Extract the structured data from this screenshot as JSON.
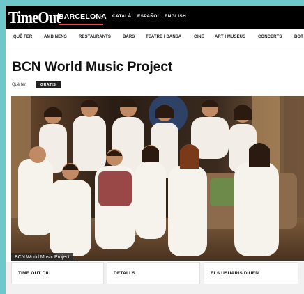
{
  "header": {
    "logo_text": "TimeOut",
    "city": "BARCELONA",
    "languages": [
      "CATALÀ",
      "ESPAÑOL",
      "ENGLISH"
    ]
  },
  "nav": {
    "items": [
      "QUÈ FER",
      "AMB NENS",
      "RESTAURANTS",
      "BARS",
      "TEATRE I DANSA",
      "CINE",
      "ART I MUSEUS",
      "CONCERTS",
      "BOT"
    ]
  },
  "page": {
    "title": "BCN World Music Project",
    "category_label": "Què fer",
    "badge": "GRATIS"
  },
  "photo": {
    "caption": "BCN World Music Project"
  },
  "tabs": [
    "TIME OUT DIU",
    "DETALLS",
    "ELS USUARIS DIUEN"
  ],
  "colors": {
    "border_bg": "#6fc7cc",
    "header_bg": "#000000",
    "accent_underline": "#e5484d",
    "badge_bg": "#222222"
  }
}
